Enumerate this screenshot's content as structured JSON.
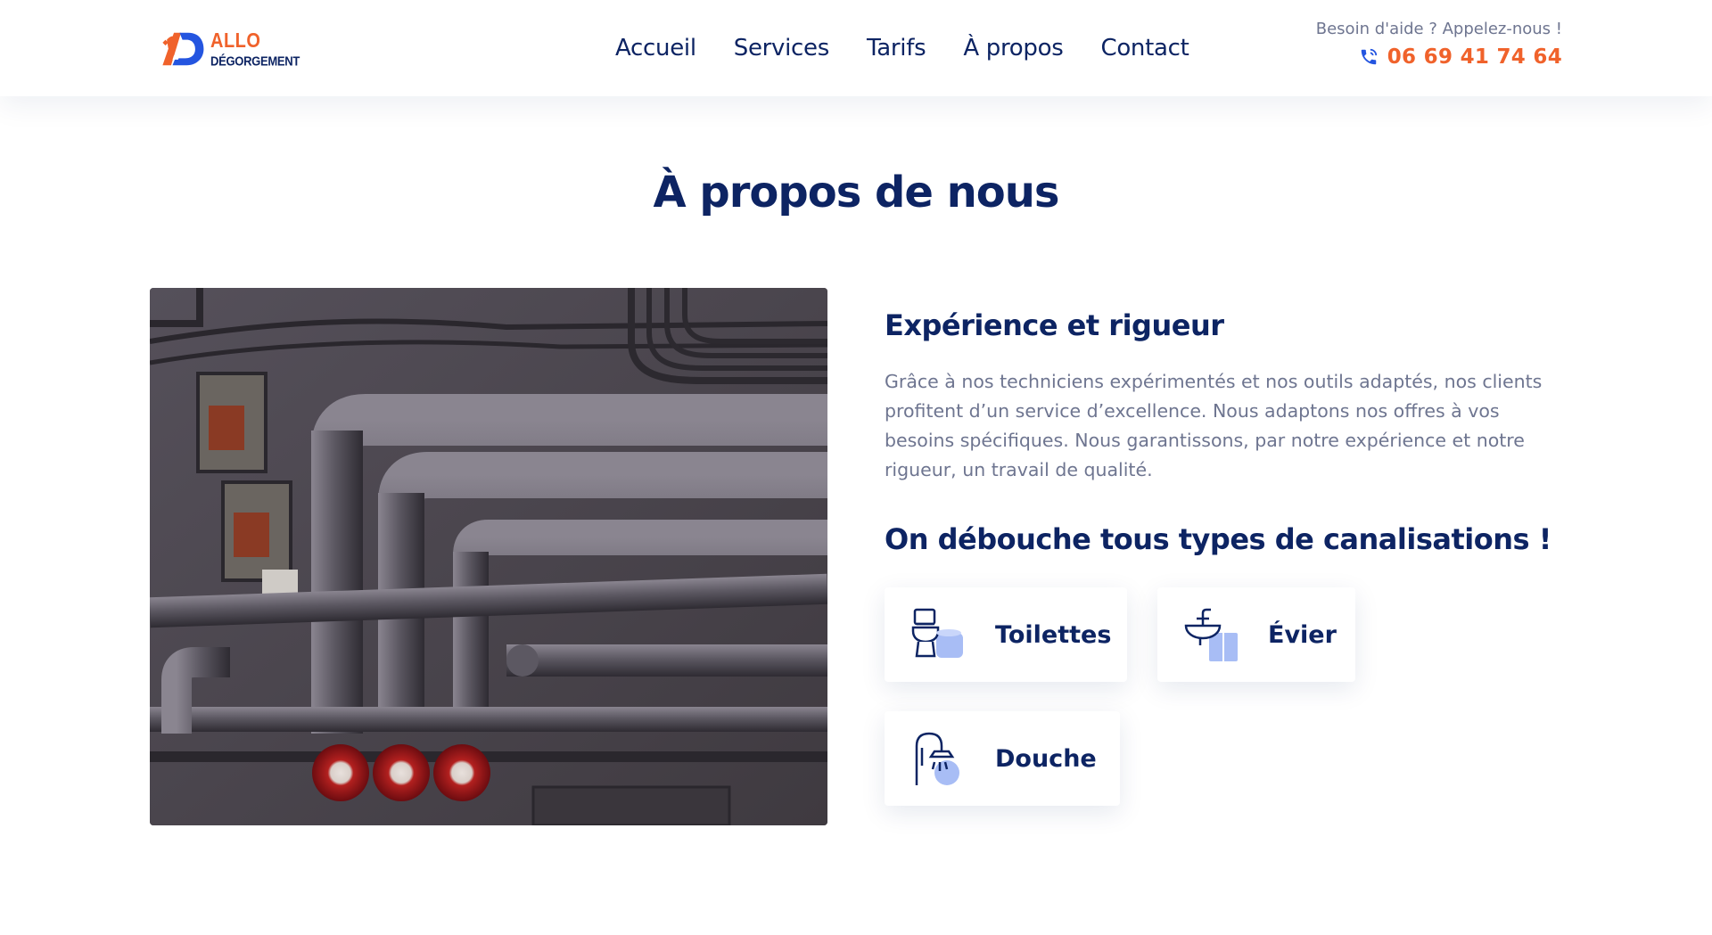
{
  "brand": {
    "name_top": "ALLO",
    "name_bottom": "DÉGORGEMENT",
    "orange": "#f0622b",
    "navy": "#0d2463"
  },
  "nav": {
    "items": [
      {
        "label": "Accueil"
      },
      {
        "label": "Services"
      },
      {
        "label": "Tarifs"
      },
      {
        "label": "À propos"
      },
      {
        "label": "Contact"
      }
    ]
  },
  "contact": {
    "help_text": "Besoin d'aide ? Appelez-nous !",
    "phone": "06 69 41 74 64",
    "phone_icon": "phone-icon"
  },
  "about": {
    "title": "À propos de nous",
    "image_alt": "pipes-photo",
    "heading": "Expérience et rigueur",
    "paragraph": "Grâce à nos techniciens expérimentés et nos outils adaptés, nos clients profitent d’un service d’excellence. Nous adaptons nos offres à vos besoins spécifiques. Nous garantissons, par notre expérience et notre rigueur, un travail de qualité.",
    "subheading": "On débouche tous types de canalisations !",
    "cards": [
      {
        "label": "Toilettes",
        "icon": "toilet-icon"
      },
      {
        "label": "Évier",
        "icon": "sink-icon"
      },
      {
        "label": "Douche",
        "icon": "shower-icon"
      }
    ]
  }
}
